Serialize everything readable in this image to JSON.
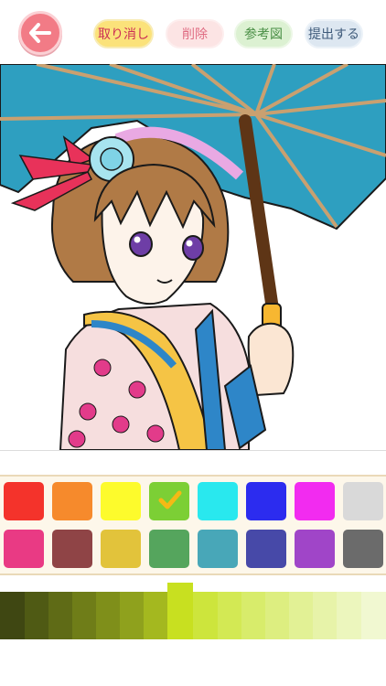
{
  "toolbar": {
    "back_icon": "arrow-left-icon",
    "undo_label": "取り消し",
    "delete_label": "削除",
    "reference_label": "参考図",
    "submit_label": "提出する"
  },
  "canvas": {
    "subject": "coloring-page-girl-with-umbrella"
  },
  "palette": {
    "selected_index": 3,
    "row1": [
      "#f4332b",
      "#f68a2c",
      "#fdfb2c",
      "#7ccf35",
      "#29e8ee",
      "#2c2cef",
      "#f22bf0",
      "#d9d9d9"
    ],
    "row2": [
      "#e93a84",
      "#8f4446",
      "#e2c33b",
      "#55a55d",
      "#48a7b8",
      "#4749a8",
      "#a045c8",
      "#6b6b6b"
    ]
  },
  "shades": {
    "selected_index": 7,
    "colors": [
      "#3f4712",
      "#4f5a14",
      "#5f6b16",
      "#6f7d18",
      "#7f8f1a",
      "#8fa11d",
      "#a4b81f",
      "#c8e020",
      "#cde53c",
      "#d3e954",
      "#d8ec6b",
      "#ddee80",
      "#e2f195",
      "#e7f3a9",
      "#ecf6bd",
      "#f1f8d1"
    ]
  }
}
